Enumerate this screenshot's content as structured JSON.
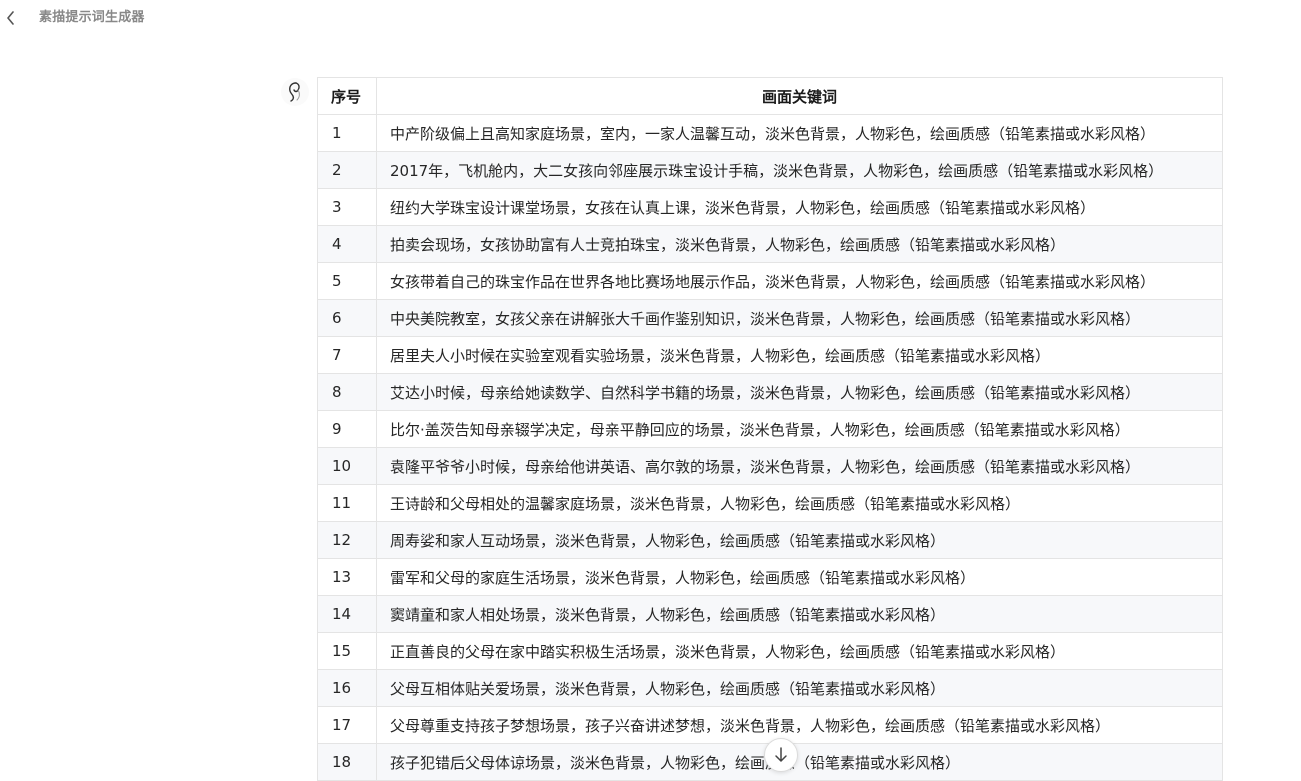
{
  "header": {
    "title": "素描提示词生成器",
    "back_icon": "chevron-left-icon"
  },
  "avatar": {
    "icon": "bot-avatar-icon"
  },
  "table": {
    "headers": {
      "num": "序号",
      "keywords": "画面关键词"
    },
    "rows": [
      {
        "num": "1",
        "text": "中产阶级偏上且高知家庭场景，室内，一家人温馨互动，淡米色背景，人物彩色，绘画质感（铅笔素描或水彩风格）"
      },
      {
        "num": "2",
        "text": "2017年，飞机舱内，大二女孩向邻座展示珠宝设计手稿，淡米色背景，人物彩色，绘画质感（铅笔素描或水彩风格）"
      },
      {
        "num": "3",
        "text": "纽约大学珠宝设计课堂场景，女孩在认真上课，淡米色背景，人物彩色，绘画质感（铅笔素描或水彩风格）"
      },
      {
        "num": "4",
        "text": "拍卖会现场，女孩协助富有人士竞拍珠宝，淡米色背景，人物彩色，绘画质感（铅笔素描或水彩风格）"
      },
      {
        "num": "5",
        "text": "女孩带着自己的珠宝作品在世界各地比赛场地展示作品，淡米色背景，人物彩色，绘画质感（铅笔素描或水彩风格）"
      },
      {
        "num": "6",
        "text": "中央美院教室，女孩父亲在讲解张大千画作鉴别知识，淡米色背景，人物彩色，绘画质感（铅笔素描或水彩风格）"
      },
      {
        "num": "7",
        "text": "居里夫人小时候在实验室观看实验场景，淡米色背景，人物彩色，绘画质感（铅笔素描或水彩风格）"
      },
      {
        "num": "8",
        "text": "艾达小时候，母亲给她读数学、自然科学书籍的场景，淡米色背景，人物彩色，绘画质感（铅笔素描或水彩风格）"
      },
      {
        "num": "9",
        "text": "比尔·盖茨告知母亲辍学决定，母亲平静回应的场景，淡米色背景，人物彩色，绘画质感（铅笔素描或水彩风格）"
      },
      {
        "num": "10",
        "text": "袁隆平爷爷小时候，母亲给他讲英语、高尔敦的场景，淡米色背景，人物彩色，绘画质感（铅笔素描或水彩风格）"
      },
      {
        "num": "11",
        "text": "王诗龄和父母相处的温馨家庭场景，淡米色背景，人物彩色，绘画质感（铅笔素描或水彩风格）"
      },
      {
        "num": "12",
        "text": "周寿娑和家人互动场景，淡米色背景，人物彩色，绘画质感（铅笔素描或水彩风格）"
      },
      {
        "num": "13",
        "text": "雷军和父母的家庭生活场景，淡米色背景，人物彩色，绘画质感（铅笔素描或水彩风格）"
      },
      {
        "num": "14",
        "text": "窦靖童和家人相处场景，淡米色背景，人物彩色，绘画质感（铅笔素描或水彩风格）"
      },
      {
        "num": "15",
        "text": "正直善良的父母在家中踏实积极生活场景，淡米色背景，人物彩色，绘画质感（铅笔素描或水彩风格）"
      },
      {
        "num": "16",
        "text": "父母互相体贴关爱场景，淡米色背景，人物彩色，绘画质感（铅笔素描或水彩风格）"
      },
      {
        "num": "17",
        "text": "父母尊重支持孩子梦想场景，孩子兴奋讲述梦想，淡米色背景，人物彩色，绘画质感（铅笔素描或水彩风格）"
      },
      {
        "num": "18",
        "text": "孩子犯错后父母体谅场景，淡米色背景，人物彩色，绘画质感（铅笔素描或水彩风格）"
      }
    ]
  },
  "scroll_button": {
    "icon": "arrow-down-icon"
  }
}
